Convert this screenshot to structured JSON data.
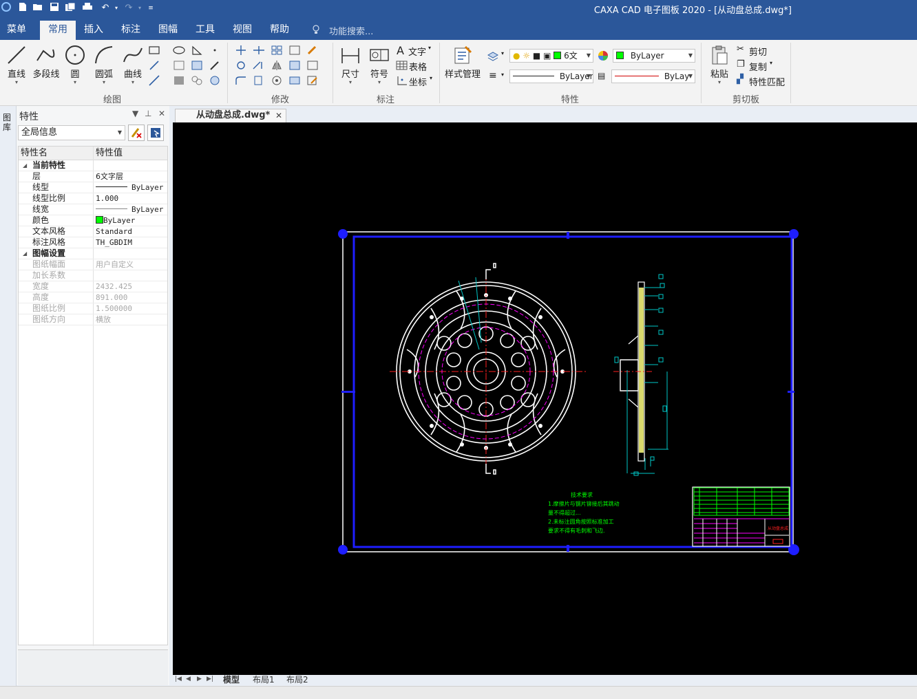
{
  "title": "CAXA CAD 电子图板 2020 - [从动盘总成.dwg*]",
  "menu": {
    "tabs": [
      {
        "label": "菜单"
      },
      {
        "label": "常用"
      },
      {
        "label": "插入"
      },
      {
        "label": "标注"
      },
      {
        "label": "图幅"
      },
      {
        "label": "工具"
      },
      {
        "label": "视图"
      },
      {
        "label": "帮助"
      }
    ],
    "search_label": "功能搜索..."
  },
  "ribbon": {
    "draw": {
      "group_label": "绘图",
      "line": "直线",
      "polyline": "多段线",
      "circle": "圆",
      "arc": "圆弧",
      "curve": "曲线"
    },
    "modify": {
      "group_label": "修改"
    },
    "annotate": {
      "group_label": "标注",
      "dimension": "尺寸",
      "symbol": "符号",
      "text": "文字",
      "table": "表格",
      "coordinate": "坐标"
    },
    "properties": {
      "group_label": "特性",
      "style_manager": "样式管理",
      "layer_name": "6文",
      "color_value": "ByLayer",
      "linetype_value": "ByLayer",
      "lineweight_value": "ByLay"
    },
    "clipboard": {
      "group_label": "剪切板",
      "paste": "粘贴",
      "cut": "剪切",
      "copy": "复制",
      "match": "特性匹配"
    }
  },
  "left_strip_label": "图库",
  "properties_panel": {
    "title": "特性",
    "scope": "全局信息",
    "col_name": "特性名",
    "col_value": "特性值",
    "current": {
      "label": "当前特性",
      "rows": [
        {
          "name": "层",
          "value": "6文字层"
        },
        {
          "name": "线型",
          "value": "ByLayer"
        },
        {
          "name": "线型比例",
          "value": "1.000"
        },
        {
          "name": "线宽",
          "value": "ByLayer"
        },
        {
          "name": "颜色",
          "value": "ByLayer"
        },
        {
          "name": "文本风格",
          "value": "Standard"
        },
        {
          "name": "标注风格",
          "value": "TH_GBDIM"
        }
      ]
    },
    "sheet": {
      "label": "图幅设置",
      "rows": [
        {
          "name": "图纸幅面",
          "value": "用户自定义"
        },
        {
          "name": "加长系数",
          "value": ""
        },
        {
          "name": "宽度",
          "value": "2432.425"
        },
        {
          "name": "高度",
          "value": "891.000"
        },
        {
          "name": "图纸比例",
          "value": "1.500000"
        },
        {
          "name": "图纸方向",
          "value": "横放"
        }
      ]
    }
  },
  "document_tab": "从动盘总成.dwg*",
  "drawing": {
    "notes_title": "技术要求",
    "notes": [
      "1.摩擦片与钢片铆接后其跳动",
      "量不得超过...",
      "2.未标注圆角按照标准加工",
      "要求不得有毛刺和飞边."
    ],
    "title_block_name": "从动盘总成"
  },
  "layout_tabs": [
    {
      "label": "模型"
    },
    {
      "label": "布局1"
    },
    {
      "label": "布局2"
    }
  ],
  "colors": {
    "titlebar": "#2b579a",
    "canvas": "#000000",
    "frame_blue": "#0000ff",
    "grip_blue": "#0000ff",
    "green": "#00ff00",
    "cyan": "#00ffff",
    "magenta": "#ff00ff",
    "red": "#ff0000",
    "yellow": "#ffff80"
  }
}
